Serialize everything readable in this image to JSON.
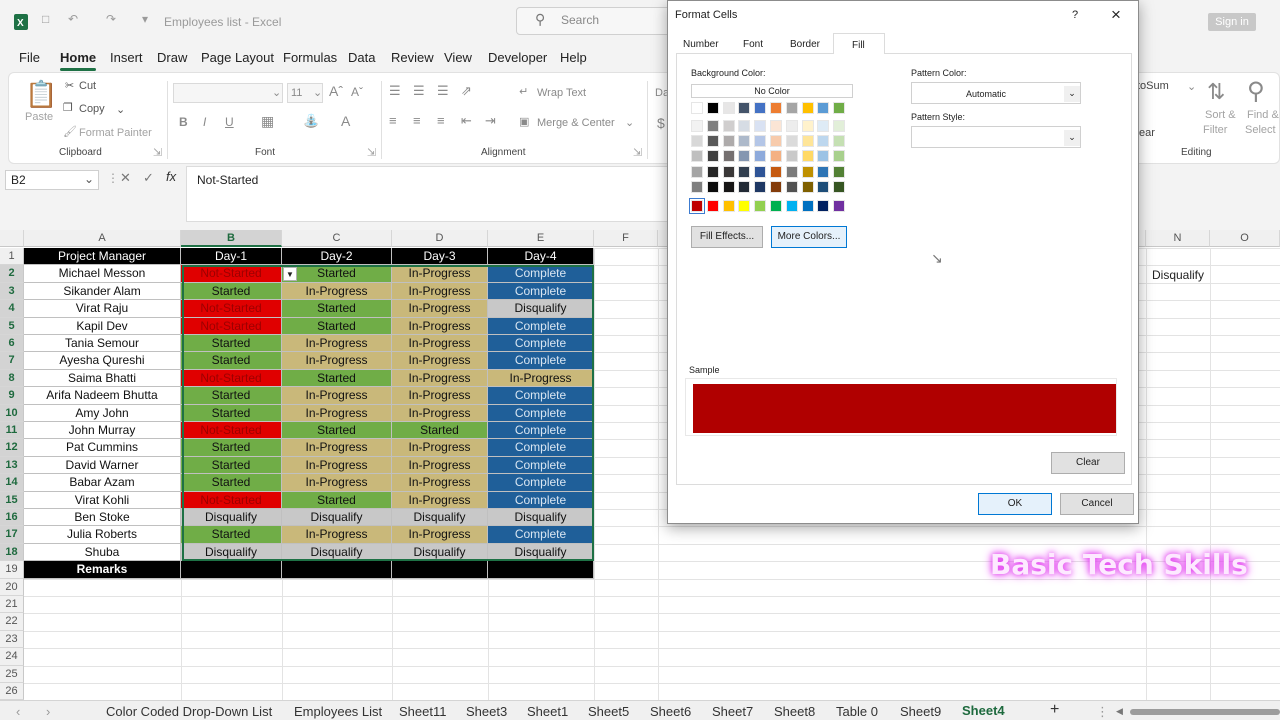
{
  "titlebar": {
    "doc_title": "Employees list  -  Excel",
    "search_placeholder": "Search",
    "signin": "Sign in"
  },
  "menu": [
    "File",
    "Home",
    "Insert",
    "Draw",
    "Page Layout",
    "Formulas",
    "Data",
    "Review",
    "View",
    "Developer",
    "Help"
  ],
  "ribbon": {
    "clipboard": {
      "paste": "Paste",
      "cut": "Cut",
      "copy": "Copy",
      "format_painter": "Format Painter",
      "group": "Clipboard"
    },
    "font": {
      "size": "11",
      "group": "Font"
    },
    "alignment": {
      "wrap": "Wrap Text",
      "merge": "Merge & Center",
      "group": "Alignment"
    },
    "editing": {
      "autosum": "toSum",
      "sort": "Sort &",
      "filter": "Filter",
      "find": "Find &",
      "select": "Select",
      "clear": "ear",
      "group": "Editing"
    }
  },
  "formula_bar": {
    "name_box": "B2",
    "fx": "fx",
    "content": "Not-Started"
  },
  "columns": [
    "A",
    "B",
    "C",
    "D",
    "E",
    "F",
    "N",
    "O"
  ],
  "rows": [
    "1",
    "2",
    "3",
    "4",
    "5",
    "6",
    "7",
    "8",
    "9",
    "10",
    "11",
    "12",
    "13",
    "14",
    "15",
    "16",
    "17",
    "18",
    "19",
    "20",
    "21",
    "22",
    "23",
    "24",
    "25",
    "26"
  ],
  "sheet": {
    "headers": [
      "Project Manager",
      "Day-1",
      "Day-2",
      "Day-3",
      "Day-4"
    ],
    "data": [
      [
        "Michael Messon",
        "Not-Started",
        "Started",
        "In-Progress",
        "Complete"
      ],
      [
        "Sikander Alam",
        "Started",
        "In-Progress",
        "In-Progress",
        "Complete"
      ],
      [
        "Virat Raju",
        "Not-Started",
        "Started",
        "In-Progress",
        "Disqualify"
      ],
      [
        "Kapil Dev",
        "Not-Started",
        "Started",
        "In-Progress",
        "Complete"
      ],
      [
        "Tania Semour",
        "Started",
        "In-Progress",
        "In-Progress",
        "Complete"
      ],
      [
        "Ayesha Qureshi",
        "Started",
        "In-Progress",
        "In-Progress",
        "Complete"
      ],
      [
        "Saima Bhatti",
        "Not-Started",
        "Started",
        "In-Progress",
        "In-Progress"
      ],
      [
        "Arifa Nadeem Bhutta",
        "Started",
        "In-Progress",
        "In-Progress",
        "Complete"
      ],
      [
        "Amy John",
        "Started",
        "In-Progress",
        "In-Progress",
        "Complete"
      ],
      [
        "John Murray",
        "Not-Started",
        "Started",
        "Started",
        "Complete"
      ],
      [
        "Pat Cummins",
        "Started",
        "In-Progress",
        "In-Progress",
        "Complete"
      ],
      [
        "David Warner",
        "Started",
        "In-Progress",
        "In-Progress",
        "Complete"
      ],
      [
        "Babar Azam",
        "Started",
        "In-Progress",
        "In-Progress",
        "Complete"
      ],
      [
        "Virat Kohli",
        "Not-Started",
        "Started",
        "In-Progress",
        "Complete"
      ],
      [
        "Ben Stoke",
        "Disqualify",
        "Disqualify",
        "Disqualify",
        "Disqualify"
      ],
      [
        "Julia Roberts",
        "Started",
        "In-Progress",
        "In-Progress",
        "Complete"
      ],
      [
        "Shuba",
        "Disqualify",
        "Disqualify",
        "Disqualify",
        "Disqualify"
      ]
    ],
    "remarks": "Remarks",
    "side_value": "Disqualify"
  },
  "status_colors": {
    "Not-Started": "#e00000",
    "Started": "#70ad47",
    "In-Progress": "#c9b87a",
    "Complete": "#1f5f99",
    "Disqualify": "#c8c8c8"
  },
  "sheet_tabs": [
    "Color Coded Drop-Down List",
    "Employees List",
    "Sheet11",
    "Sheet3",
    "Sheet1",
    "Sheet5",
    "Sheet6",
    "Sheet7",
    "Sheet8",
    "Table 0",
    "Sheet9",
    "Sheet4"
  ],
  "dialog": {
    "title": "Format Cells",
    "help": "?",
    "close": "×",
    "tabs": [
      "Number",
      "Font",
      "Border",
      "Fill"
    ],
    "background_color_label": "Background Color:",
    "no_color": "No Color",
    "fill_effects": "Fill Effects...",
    "more_colors": "More Colors...",
    "pattern_color_label": "Pattern Color:",
    "pattern_color_value": "Automatic",
    "pattern_style_label": "Pattern Style:",
    "sample_label": "Sample",
    "sample_color": "#b00000",
    "clear": "Clear",
    "ok": "OK",
    "cancel": "Cancel"
  },
  "watermark": "Basic Tech Skills"
}
